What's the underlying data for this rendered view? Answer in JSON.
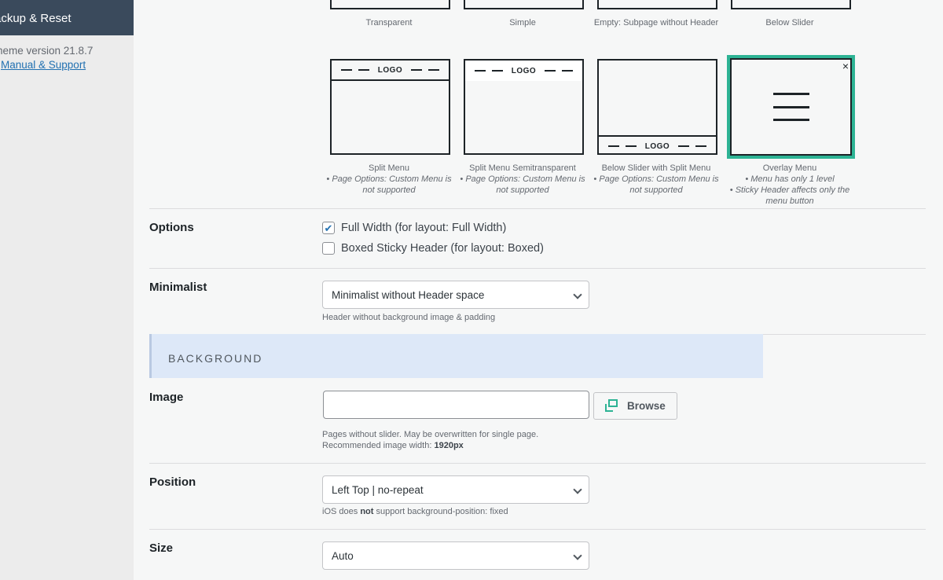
{
  "sidebar": {
    "active_item": "ackup & Reset",
    "version": "heme version 21.8.7",
    "support_link": "Manual & Support"
  },
  "layouts_top": [
    "Transparent",
    "Simple",
    "Empty: Subpage without Header",
    "Below Slider"
  ],
  "layouts": [
    {
      "name": "Split Menu",
      "notes": [
        "• Page Options: Custom Menu is not supported"
      ],
      "logo_text": "LOGO"
    },
    {
      "name": "Split Menu Semitransparent",
      "notes": [
        "• Page Options: Custom Menu is not supported"
      ],
      "logo_text": "LOGO"
    },
    {
      "name": "Below Slider with Split Menu",
      "notes": [
        "• Page Options: Custom Menu is not supported"
      ],
      "logo_text": "LOGO"
    },
    {
      "name": "Overlay Menu",
      "notes": [
        "• Menu has only 1 level",
        "• Sticky Header affects only the menu button"
      ],
      "close_glyph": "×"
    }
  ],
  "options": {
    "label": "Options",
    "checkboxes": [
      {
        "label": "Full Width (for layout: Full Width)",
        "checked": true
      },
      {
        "label": "Boxed Sticky Header (for layout: Boxed)",
        "checked": false
      }
    ]
  },
  "minimalist": {
    "label": "Minimalist",
    "value": "Minimalist without Header space",
    "help": "Header without background image & padding"
  },
  "background_section": {
    "title": "BACKGROUND"
  },
  "image": {
    "label": "Image",
    "value": "",
    "browse_label": "Browse",
    "help_line1": "Pages without slider. May be overwritten for single page.",
    "help_line2_prefix": "Recommended image width: ",
    "help_line2_value": "1920px"
  },
  "position": {
    "label": "Position",
    "value": "Left Top | no-repeat",
    "help_prefix": "iOS does ",
    "help_bold": "not",
    "help_suffix": " support background-position: fixed"
  },
  "size": {
    "label": "Size",
    "value": "Auto"
  },
  "colors": {
    "accent": "#2db394",
    "topbar_accent": "#7ab829",
    "section_bg": "#dde8f8",
    "sidebar_active": "#3a4a5c"
  }
}
